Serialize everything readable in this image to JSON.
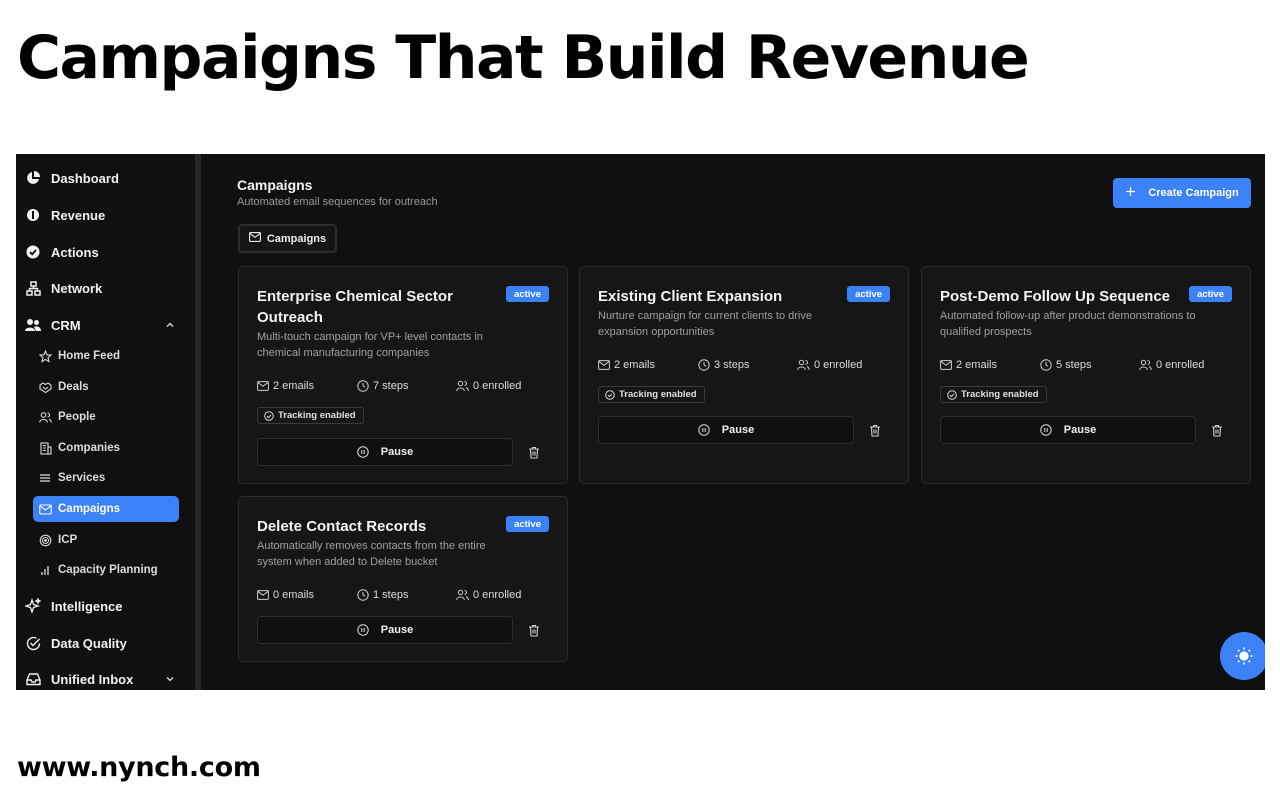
{
  "headline": "Campaigns That Build Revenue",
  "footer_url": "www.nynch.com",
  "sidebar": {
    "items": [
      {
        "label": "Dashboard",
        "icon": "pie-chart-icon"
      },
      {
        "label": "Revenue",
        "icon": "revenue-icon"
      },
      {
        "label": "Actions",
        "icon": "check-circle-icon"
      },
      {
        "label": "Network",
        "icon": "network-icon"
      },
      {
        "label": "CRM",
        "icon": "users-icon"
      },
      {
        "label": "Intelligence",
        "icon": "sparkles-icon"
      },
      {
        "label": "Data Quality",
        "icon": "check-badge-icon"
      },
      {
        "label": "Unified Inbox",
        "icon": "inbox-icon"
      }
    ],
    "crm_sub": [
      {
        "label": "Home Feed",
        "icon": "star-icon"
      },
      {
        "label": "Deals",
        "icon": "handshake-icon"
      },
      {
        "label": "People",
        "icon": "people-icon"
      },
      {
        "label": "Companies",
        "icon": "building-icon"
      },
      {
        "label": "Services",
        "icon": "list-icon"
      },
      {
        "label": "Campaigns",
        "icon": "mail-icon",
        "active": true
      },
      {
        "label": "ICP",
        "icon": "target-icon"
      },
      {
        "label": "Capacity Planning",
        "icon": "bar-chart-icon"
      }
    ]
  },
  "main": {
    "title": "Campaigns",
    "subtitle": "Automated email sequences for outreach",
    "create_button": "Create Campaign",
    "tab_label": "Campaigns"
  },
  "campaigns": [
    {
      "title": "Enterprise Chemical Sector Outreach",
      "status": "active",
      "description": "Multi-touch campaign for VP+ level contacts in chemical manufacturing companies",
      "emails": "2 emails",
      "steps": "7 steps",
      "enrolled": "0 enrolled",
      "tracking": "Tracking enabled",
      "action": "Pause"
    },
    {
      "title": "Existing Client Expansion",
      "status": "active",
      "description": "Nurture campaign for current clients to drive expansion opportunities",
      "emails": "2 emails",
      "steps": "3 steps",
      "enrolled": "0 enrolled",
      "tracking": "Tracking enabled",
      "action": "Pause"
    },
    {
      "title": "Post-Demo Follow Up Sequence",
      "status": "active",
      "description": "Automated follow-up after product demonstrations to qualified prospects",
      "emails": "2 emails",
      "steps": "5 steps",
      "enrolled": "0 enrolled",
      "tracking": "Tracking enabled",
      "action": "Pause"
    },
    {
      "title": "Delete Contact Records",
      "status": "active",
      "description": "Automatically removes contacts from the entire system when added to Delete bucket",
      "emails": "0 emails",
      "steps": "1 steps",
      "enrolled": "0 enrolled",
      "action": "Pause"
    }
  ],
  "colors": {
    "accent": "#3b82f6",
    "app_background": "#101010",
    "card_background": "#161616"
  }
}
